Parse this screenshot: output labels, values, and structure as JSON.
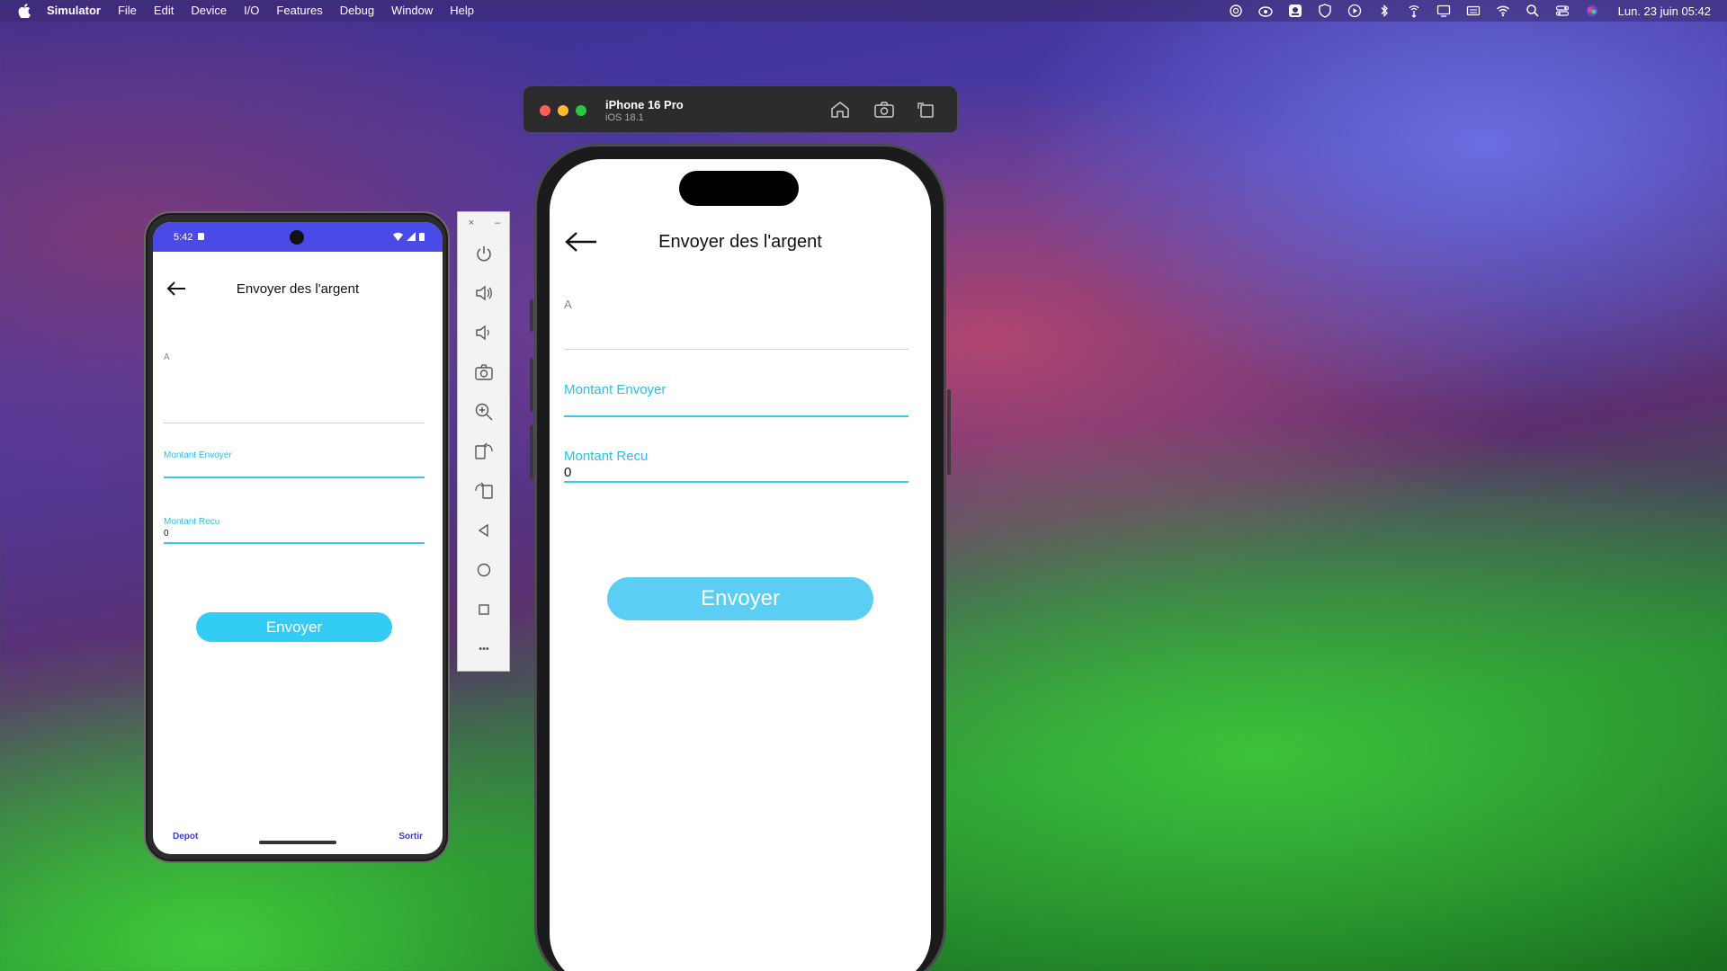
{
  "menubar": {
    "app_name": "Simulator",
    "items": [
      "File",
      "Edit",
      "Device",
      "I/O",
      "Features",
      "Debug",
      "Window",
      "Help"
    ],
    "clock": "Lun. 23 juin 05:42",
    "status_icons": [
      "openai-icon",
      "creative-cloud-icon",
      "webcam-icon",
      "shield-icon",
      "play-icon",
      "bluetooth-icon",
      "airdrop-icon",
      "display-icon",
      "keyboard-icon",
      "wifi-icon",
      "search-icon",
      "control-center-icon",
      "siri-icon"
    ]
  },
  "android": {
    "status_time": "5:42",
    "screen_title": "Envoyer des l'argent",
    "field_a_label": "A",
    "field_montant_envoyer_label": "Montant Envoyer",
    "field_montant_recu_label": "Montant Recu",
    "field_montant_recu_value": "0",
    "send_button": "Envoyer",
    "nav_left": "Depot",
    "nav_right": "Sortir"
  },
  "emulator_toolbar": {
    "close": "×",
    "minimize": "–",
    "more": "•••"
  },
  "ios_window": {
    "device_name": "iPhone 16 Pro",
    "os_version": "iOS 18.1",
    "traffic_colors": [
      "#ff5f57",
      "#febc2e",
      "#28c840"
    ]
  },
  "ios": {
    "screen_title": "Envoyer des l'argent",
    "field_a_label": "A",
    "field_montant_envoyer_label": "Montant Envoyer",
    "field_montant_recu_label": "Montant Recu",
    "field_montant_recu_value": "0",
    "send_button": "Envoyer"
  },
  "colors": {
    "accent": "#28c0ea",
    "button": "#33ccf5",
    "android_status": "#4a4ae6"
  }
}
